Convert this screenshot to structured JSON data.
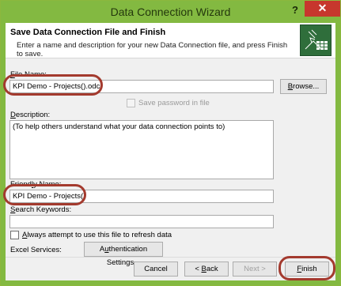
{
  "window": {
    "title": "Data Connection Wizard",
    "help_label": "?",
    "close_label": "✕"
  },
  "header": {
    "title": "Save Data Connection File and Finish",
    "description": "Enter a name and description for your new Data Connection file, and press Finish to save.",
    "icon": "data-connection-wizard-icon"
  },
  "file_name": {
    "label_prefix": "",
    "label_underlined": "F",
    "label_rest": "ile Name:",
    "value": "KPI Demo - Projects().odc",
    "browse_label_underlined": "B",
    "browse_label_rest": "rowse..."
  },
  "save_password": {
    "label": "Save password in file",
    "checked": false,
    "enabled": false
  },
  "description": {
    "label_underlined": "D",
    "label_rest": "escription:",
    "value": "(To help others understand what your data connection points to)"
  },
  "friendly_name": {
    "label_prefix": "Friend",
    "label_underlined": "l",
    "label_rest": "y Name:",
    "value": "KPI Demo - Projects()"
  },
  "search_keywords": {
    "label_underlined": "S",
    "label_rest": "earch Keywords:",
    "value": ""
  },
  "always_attempt": {
    "label_underlined": "A",
    "label_rest": "lways attempt to use this file to refresh data",
    "checked": false
  },
  "excel_services": {
    "label": "Excel Services:",
    "button_prefix": "A",
    "button_underlined": "u",
    "button_rest": "thentication Settings..."
  },
  "footer": {
    "cancel_label": "Cancel",
    "back_prefix": "< ",
    "back_underlined": "B",
    "back_rest": "ack",
    "next_label": "Next >",
    "finish_underlined": "F",
    "finish_rest": "inish"
  },
  "colors": {
    "accent": "#83b941",
    "close": "#c7372d",
    "highlight_ring": "#a33a2e"
  }
}
